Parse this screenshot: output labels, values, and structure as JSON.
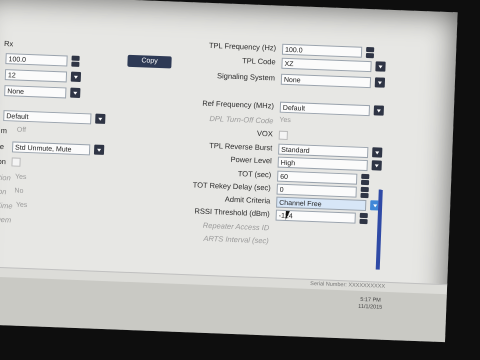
{
  "left_panel": {
    "label_top": "Rx",
    "freq_value": "100.0",
    "second_value": "12",
    "third_value": "None",
    "default_value": "Default",
    "off_label": "Off",
    "squelch_value": "Std Unmute, Mute",
    "partial_labels": [
      "m",
      "le",
      "on",
      "ition",
      "ion",
      "Time",
      "Dem"
    ],
    "partial_values": [
      "Yes",
      "No",
      "Yes"
    ]
  },
  "copy_button": "Copy",
  "right_panel": {
    "rows": [
      {
        "label": "TPL Frequency (Hz)",
        "value": "100.0",
        "control": "spin"
      },
      {
        "label": "TPL Code",
        "value": "XZ",
        "control": "dropdown"
      },
      {
        "label": "Signaling System",
        "value": "None",
        "control": "dropdown"
      },
      {
        "label": "Ref Frequency (MHz)",
        "value": "Default",
        "control": "dropdown"
      },
      {
        "label": "DPL Turn-Off Code",
        "value": "Yes",
        "control": "disabled"
      },
      {
        "label": "VOX",
        "value": "",
        "control": "checkbox"
      },
      {
        "label": "TPL Reverse Burst",
        "value": "Standard",
        "control": "dropdown"
      },
      {
        "label": "Power Level",
        "value": "High",
        "control": "dropdown"
      },
      {
        "label": "TOT (sec)",
        "value": "60",
        "control": "spin"
      },
      {
        "label": "TOT Rekey Delay (sec)",
        "value": "0",
        "control": "spin"
      },
      {
        "label": "Admit Criteria",
        "value": "Channel Free",
        "control": "dropdown-active"
      },
      {
        "label": "RSSI Threshold (dBm)",
        "value": "-124",
        "control": "spin"
      },
      {
        "label": "Repeater Access ID",
        "value": "",
        "control": "disabled"
      },
      {
        "label": "ARTS Interval (sec)",
        "value": "",
        "control": "disabled"
      }
    ]
  },
  "status_bar": {
    "text": "Serial Number: XXXXXXXXXX"
  },
  "clock": {
    "time": "5:17 PM",
    "date": "11/1/2015"
  }
}
